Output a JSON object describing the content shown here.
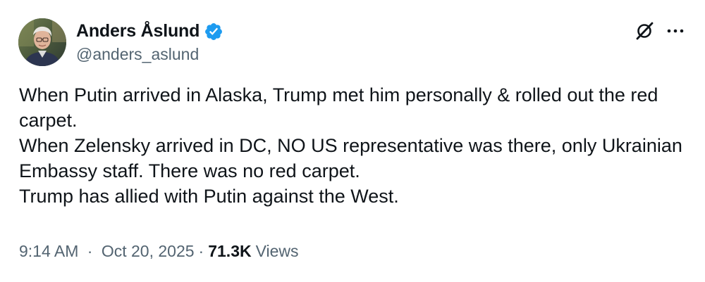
{
  "author": {
    "display_name": "Anders Åslund",
    "handle": "@anders_aslund",
    "verified": true,
    "verified_color": "#1d9bf0",
    "avatar_icon": "profile-photo"
  },
  "actions": {
    "grok_icon": "grok-icon",
    "more_icon": "more-horizontal-icon"
  },
  "tweet": {
    "lines": [
      "When Putin arrived in Alaska, Trump met him personally & rolled out the red carpet.",
      "When Zelensky arrived in DC, NO US representative was there, only Ukrainian Embassy staff. There was no red carpet.",
      "Trump has allied with Putin against the West."
    ]
  },
  "meta": {
    "time": "9:14 AM",
    "separator": "·",
    "date": "Oct 20, 2025",
    "views_count": "71.3K",
    "views_label": "Views"
  },
  "colors": {
    "text": "#0f1419",
    "secondary": "#536471",
    "background": "#ffffff"
  }
}
